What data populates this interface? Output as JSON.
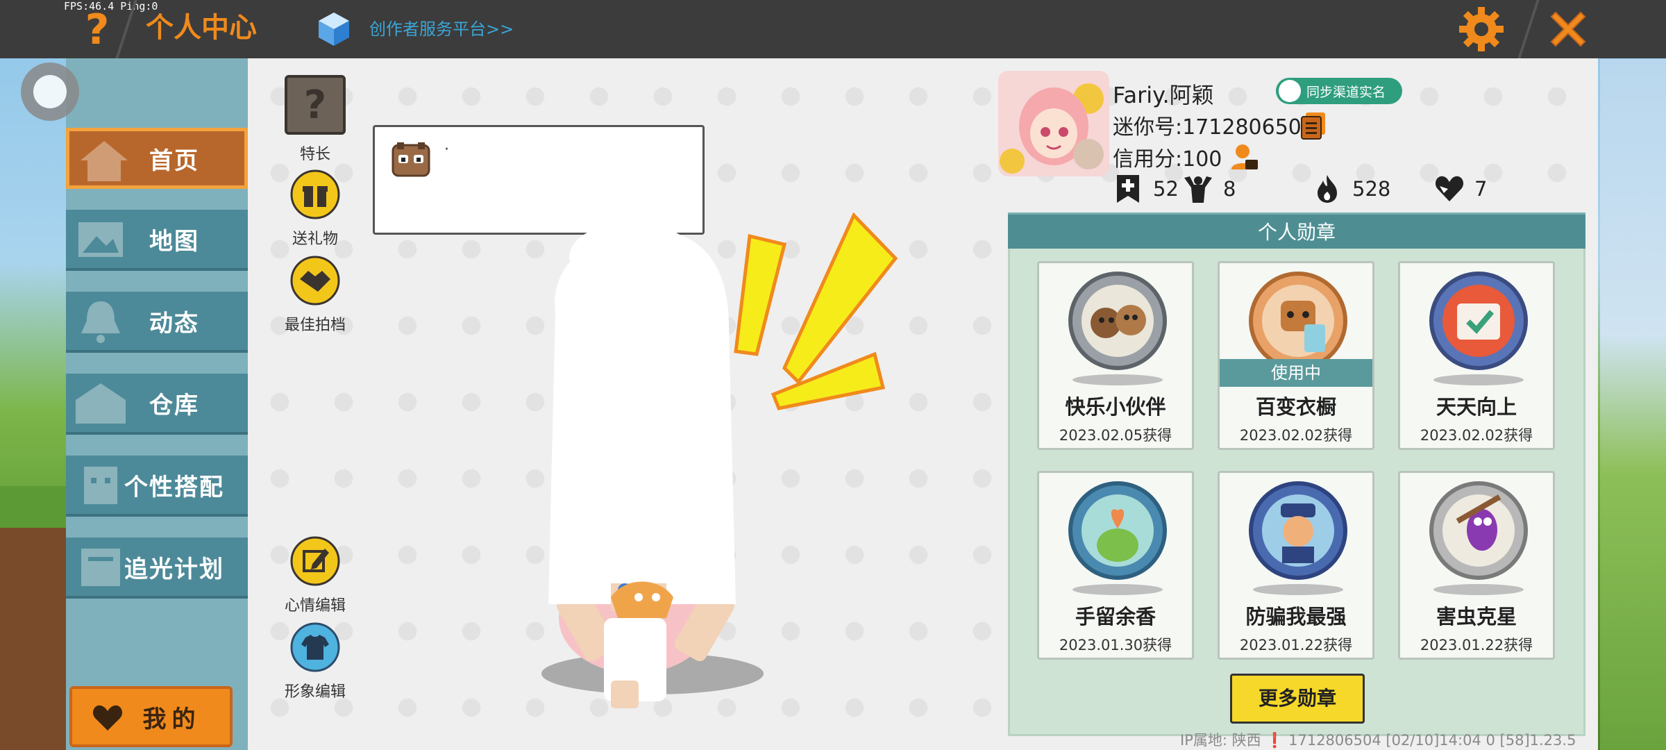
{
  "debug": {
    "fps": "FPS:46.4  Ping:0"
  },
  "header": {
    "help_label": "?",
    "title": "个人中心",
    "creator_link": "创作者服务平台>>"
  },
  "nav": {
    "items": [
      {
        "label": "首页",
        "active": true
      },
      {
        "label": "地图"
      },
      {
        "label": "动态"
      },
      {
        "label": "仓库"
      },
      {
        "label": "个性搭配"
      },
      {
        "label": "追光计划"
      }
    ],
    "mine_label": "我的"
  },
  "tools": {
    "skill": "特长",
    "gift": "送礼物",
    "best_photo": "最佳拍档",
    "mood_edit": "心情编辑",
    "avatar_edit": "形象编辑"
  },
  "speech": {
    "text": "·"
  },
  "profile": {
    "nickname": "Fariy.阿颖",
    "sync_badge": "同步渠道实名",
    "mini_id": "迷你号:1712806504",
    "credit": "信用分:100",
    "stats": {
      "plus": "52",
      "fans": "8",
      "fire": "528",
      "likes": "7"
    }
  },
  "badges": {
    "title": "个人勋章",
    "in_use_label": "使用中",
    "items": [
      {
        "name": "快乐小伙伴",
        "date": "2023.02.05获得"
      },
      {
        "name": "百变衣橱",
        "date": "2023.02.02获得",
        "in_use": true
      },
      {
        "name": "天天向上",
        "date": "2023.02.02获得"
      },
      {
        "name": "手留余香",
        "date": "2023.01.30获得"
      },
      {
        "name": "防骗我最强",
        "date": "2023.01.22获得"
      },
      {
        "name": "害虫克星",
        "date": "2023.01.22获得"
      }
    ],
    "more_label": "更多勋章"
  },
  "footer": {
    "info": "IP属地: 陕西 ❗    1712806504    [02/10]14:04 0  [58]1.23.5"
  },
  "colors": {
    "accent_orange": "#f08a1c",
    "teal": "#4e8e93",
    "nav_blue": "#4d8a99"
  }
}
